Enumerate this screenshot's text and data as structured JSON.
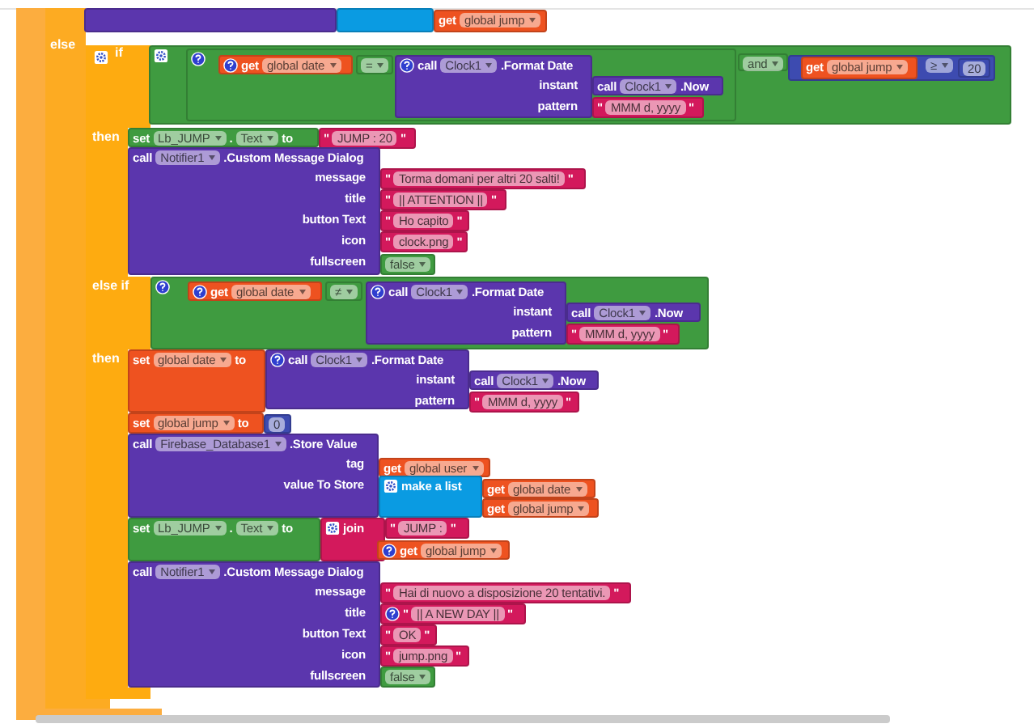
{
  "control": {
    "labels": [
      {
        "kind": "label",
        "text": "else"
      },
      {
        "kind": "gear"
      },
      {
        "kind": "label",
        "text": "if"
      },
      {
        "kind": "label",
        "text": "then"
      },
      {
        "kind": "label",
        "text": "else if"
      },
      {
        "kind": "label",
        "text": "then"
      }
    ]
  },
  "blocks": [
    {
      "kind": "procedure"
    },
    {
      "kind": "list"
    },
    {
      "kind": "variable_get",
      "parts": [
        {
          "kind": "label",
          "text": "get"
        },
        {
          "kind": "dropdown",
          "text": "global jump"
        }
      ]
    },
    {
      "kind": "logic",
      "parts": [
        {
          "kind": "gear"
        }
      ]
    },
    {
      "kind": "logic",
      "parts": [
        {
          "kind": "help"
        }
      ]
    },
    {
      "kind": "variable_get",
      "parts": [
        {
          "kind": "help"
        },
        {
          "kind": "label",
          "text": "get"
        },
        {
          "kind": "dropdown",
          "text": "global date"
        }
      ]
    },
    {
      "kind": "logic",
      "parts": [
        {
          "kind": "dropdown",
          "text": "="
        }
      ]
    },
    {
      "kind": "procedure",
      "parts": [
        {
          "kind": "help"
        },
        {
          "kind": "label",
          "text": "call"
        },
        {
          "kind": "dropdown",
          "text": "Clock1"
        },
        {
          "kind": "label",
          "text": ".Format Date"
        }
      ],
      "inputs": [
        "instant",
        "pattern"
      ]
    },
    {
      "kind": "procedure",
      "parts": [
        {
          "kind": "label",
          "text": "call"
        },
        {
          "kind": "dropdown",
          "text": "Clock1"
        },
        {
          "kind": "label",
          "text": ".Now"
        }
      ]
    },
    {
      "kind": "text",
      "parts": [
        {
          "kind": "label",
          "text": "\""
        },
        {
          "kind": "field",
          "text": "MMM d, yyyy"
        },
        {
          "kind": "label",
          "text": "\""
        }
      ]
    },
    {
      "kind": "logic",
      "parts": [
        {
          "kind": "dropdown",
          "text": "and"
        }
      ]
    },
    {
      "kind": "variable_get",
      "parts": [
        {
          "kind": "label",
          "text": "get"
        },
        {
          "kind": "dropdown",
          "text": "global jump"
        }
      ]
    },
    {
      "kind": "math",
      "parts": [
        {
          "kind": "dropdown",
          "text": "≥"
        }
      ]
    },
    {
      "kind": "math",
      "parts": [
        {
          "kind": "field",
          "text": "20"
        }
      ]
    },
    {
      "kind": "component_set",
      "parts": [
        {
          "kind": "label",
          "text": "set"
        },
        {
          "kind": "dropdown",
          "text": "Lb_JUMP"
        },
        {
          "kind": "label",
          "text": "."
        },
        {
          "kind": "dropdown",
          "text": "Text"
        },
        {
          "kind": "label",
          "text": "to"
        }
      ]
    },
    {
      "kind": "text",
      "parts": [
        {
          "kind": "label",
          "text": "\""
        },
        {
          "kind": "field",
          "text": "JUMP : 20"
        },
        {
          "kind": "label",
          "text": "\""
        }
      ]
    },
    {
      "kind": "procedure",
      "parts": [
        {
          "kind": "label",
          "text": "call"
        },
        {
          "kind": "dropdown",
          "text": "Notifier1"
        },
        {
          "kind": "label",
          "text": ".Custom Message Dialog"
        }
      ],
      "inputs": [
        "message",
        "title",
        "button Text",
        "icon",
        "fullscreen"
      ]
    },
    {
      "kind": "text",
      "parts": [
        {
          "kind": "label",
          "text": "\""
        },
        {
          "kind": "field",
          "text": "Torma domani per altri 20 salti!"
        },
        {
          "kind": "label",
          "text": "\""
        }
      ]
    },
    {
      "kind": "text",
      "parts": [
        {
          "kind": "label",
          "text": "\""
        },
        {
          "kind": "field",
          "text": "|| ATTENTION ||"
        },
        {
          "kind": "label",
          "text": "\""
        }
      ]
    },
    {
      "kind": "text",
      "parts": [
        {
          "kind": "label",
          "text": "\""
        },
        {
          "kind": "field",
          "text": "Ho capito"
        },
        {
          "kind": "label",
          "text": "\""
        }
      ]
    },
    {
      "kind": "text",
      "parts": [
        {
          "kind": "label",
          "text": "\""
        },
        {
          "kind": "field",
          "text": "clock.png"
        },
        {
          "kind": "label",
          "text": "\""
        }
      ]
    },
    {
      "kind": "logic",
      "parts": [
        {
          "kind": "dropdown",
          "text": "false"
        }
      ]
    },
    {
      "kind": "logic",
      "parts": [
        {
          "kind": "help"
        }
      ]
    },
    {
      "kind": "variable_get",
      "parts": [
        {
          "kind": "help"
        },
        {
          "kind": "label",
          "text": "get"
        },
        {
          "kind": "dropdown",
          "text": "global date"
        }
      ]
    },
    {
      "kind": "logic",
      "parts": [
        {
          "kind": "dropdown",
          "text": "≠"
        }
      ]
    },
    {
      "kind": "procedure",
      "parts": [
        {
          "kind": "help"
        },
        {
          "kind": "label",
          "text": "call"
        },
        {
          "kind": "dropdown",
          "text": "Clock1"
        },
        {
          "kind": "label",
          "text": ".Format Date"
        }
      ],
      "inputs": [
        "instant",
        "pattern"
      ]
    },
    {
      "kind": "procedure",
      "parts": [
        {
          "kind": "label",
          "text": "call"
        },
        {
          "kind": "dropdown",
          "text": "Clock1"
        },
        {
          "kind": "label",
          "text": ".Now"
        }
      ]
    },
    {
      "kind": "text",
      "parts": [
        {
          "kind": "label",
          "text": "\""
        },
        {
          "kind": "field",
          "text": "MMM d, yyyy"
        },
        {
          "kind": "label",
          "text": "\""
        }
      ]
    },
    {
      "kind": "variable_set",
      "parts": [
        {
          "kind": "label",
          "text": "set"
        },
        {
          "kind": "dropdown",
          "text": "global date"
        },
        {
          "kind": "label",
          "text": "to"
        }
      ]
    },
    {
      "kind": "procedure",
      "parts": [
        {
          "kind": "help"
        },
        {
          "kind": "label",
          "text": "call"
        },
        {
          "kind": "dropdown",
          "text": "Clock1"
        },
        {
          "kind": "label",
          "text": ".Format Date"
        }
      ],
      "inputs": [
        "instant",
        "pattern"
      ]
    },
    {
      "kind": "procedure",
      "parts": [
        {
          "kind": "label",
          "text": "call"
        },
        {
          "kind": "dropdown",
          "text": "Clock1"
        },
        {
          "kind": "label",
          "text": ".Now"
        }
      ]
    },
    {
      "kind": "text",
      "parts": [
        {
          "kind": "label",
          "text": "\""
        },
        {
          "kind": "field",
          "text": "MMM d, yyyy"
        },
        {
          "kind": "label",
          "text": "\""
        }
      ]
    },
    {
      "kind": "variable_set",
      "parts": [
        {
          "kind": "label",
          "text": "set"
        },
        {
          "kind": "dropdown",
          "text": "global jump"
        },
        {
          "kind": "label",
          "text": "to"
        }
      ]
    },
    {
      "kind": "math",
      "parts": [
        {
          "kind": "field",
          "text": "0"
        }
      ]
    },
    {
      "kind": "procedure",
      "parts": [
        {
          "kind": "label",
          "text": "call"
        },
        {
          "kind": "dropdown",
          "text": "Firebase_Database1"
        },
        {
          "kind": "label",
          "text": ".Store Value"
        }
      ],
      "inputs": [
        "tag",
        "value To Store"
      ]
    },
    {
      "kind": "variable_get",
      "parts": [
        {
          "kind": "label",
          "text": "get"
        },
        {
          "kind": "dropdown",
          "text": "global user"
        }
      ]
    },
    {
      "kind": "list",
      "parts": [
        {
          "kind": "gear"
        },
        {
          "kind": "label",
          "text": "make a list"
        }
      ]
    },
    {
      "kind": "variable_get",
      "parts": [
        {
          "kind": "label",
          "text": "get"
        },
        {
          "kind": "dropdown",
          "text": "global date"
        }
      ]
    },
    {
      "kind": "variable_get",
      "parts": [
        {
          "kind": "label",
          "text": "get"
        },
        {
          "kind": "dropdown",
          "text": "global jump"
        }
      ]
    },
    {
      "kind": "component_set",
      "parts": [
        {
          "kind": "label",
          "text": "set"
        },
        {
          "kind": "dropdown",
          "text": "Lb_JUMP"
        },
        {
          "kind": "label",
          "text": "."
        },
        {
          "kind": "dropdown",
          "text": "Text"
        },
        {
          "kind": "label",
          "text": "to"
        }
      ]
    },
    {
      "kind": "text",
      "parts": [
        {
          "kind": "gear"
        },
        {
          "kind": "label",
          "text": "join"
        }
      ]
    },
    {
      "kind": "text",
      "parts": [
        {
          "kind": "label",
          "text": "\""
        },
        {
          "kind": "field",
          "text": "JUMP : "
        },
        {
          "kind": "label",
          "text": "\""
        }
      ]
    },
    {
      "kind": "variable_get",
      "parts": [
        {
          "kind": "help"
        },
        {
          "kind": "label",
          "text": "get"
        },
        {
          "kind": "dropdown",
          "text": "global jump"
        }
      ]
    },
    {
      "kind": "procedure",
      "parts": [
        {
          "kind": "label",
          "text": "call"
        },
        {
          "kind": "dropdown",
          "text": "Notifier1"
        },
        {
          "kind": "label",
          "text": ".Custom Message Dialog"
        }
      ],
      "inputs": [
        "message",
        "title",
        "button Text",
        "icon",
        "fullscreen"
      ]
    },
    {
      "kind": "text",
      "parts": [
        {
          "kind": "label",
          "text": "\""
        },
        {
          "kind": "field",
          "text": "Hai di nuovo a disposizione 20 tentativi."
        },
        {
          "kind": "label",
          "text": "\""
        }
      ]
    },
    {
      "kind": "text",
      "parts": [
        {
          "kind": "help"
        },
        {
          "kind": "label",
          "text": "\""
        },
        {
          "kind": "field",
          "text": "|| A NEW DAY ||"
        },
        {
          "kind": "label",
          "text": "\""
        }
      ]
    },
    {
      "kind": "text",
      "parts": [
        {
          "kind": "label",
          "text": "\""
        },
        {
          "kind": "field",
          "text": "OK"
        },
        {
          "kind": "label",
          "text": "\""
        }
      ]
    },
    {
      "kind": "text",
      "parts": [
        {
          "kind": "label",
          "text": "\""
        },
        {
          "kind": "field",
          "text": "jump.png"
        },
        {
          "kind": "label",
          "text": "\""
        }
      ]
    },
    {
      "kind": "logic",
      "parts": [
        {
          "kind": "dropdown",
          "text": "false"
        }
      ]
    }
  ]
}
